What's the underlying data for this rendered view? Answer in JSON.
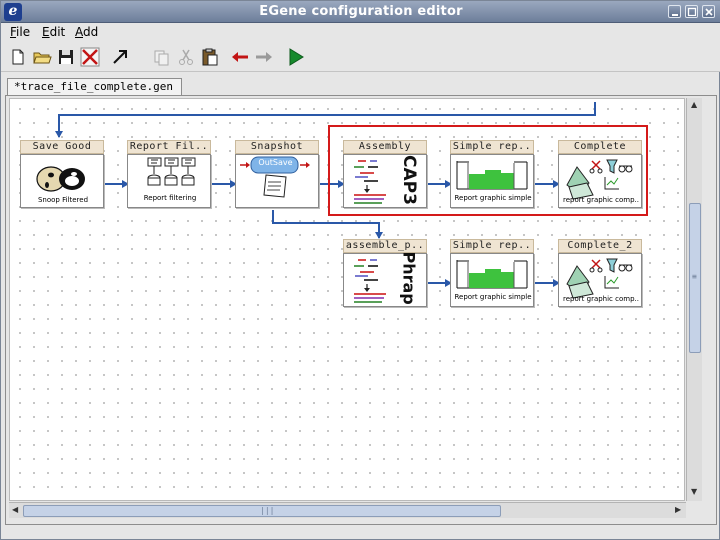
{
  "window": {
    "title": "EGene configuration editor",
    "logo_letter": "e"
  },
  "menubar": [
    {
      "label": "File",
      "mnemonic": "F",
      "rest": "ile"
    },
    {
      "label": "Edit",
      "mnemonic": "E",
      "rest": "dit"
    },
    {
      "label": "Add",
      "mnemonic": "A",
      "rest": "dd"
    }
  ],
  "toolbar": {
    "items": [
      "new-file-icon",
      "open-folder-icon",
      "save-icon",
      "delete-icon",
      "connect-arrow-icon",
      "copy-icon",
      "cut-icon",
      "paste-icon",
      "back-arrow-icon",
      "forward-arrow-icon",
      "run-icon"
    ]
  },
  "tab": {
    "label": "*trace_file_complete.gen"
  },
  "nodes": {
    "save_good": {
      "label": "Save Good",
      "caption": "Snoop Filtered"
    },
    "report_filtering": {
      "label": "Report Fil..",
      "caption": "Report filtering"
    },
    "snapshot": {
      "label": "Snapshot",
      "badge": "OutSave"
    },
    "assembly": {
      "label": "Assembly",
      "side_text": "CAP3"
    },
    "simple_rep_1": {
      "label": "Simple rep..",
      "caption": "Report graphic simple"
    },
    "complete_1": {
      "label": "Complete",
      "caption": "report graphic comp.."
    },
    "assemble_p": {
      "label": "assemble_p..",
      "side_text": "Phrap"
    },
    "simple_rep_2": {
      "label": "Simple rep..",
      "caption": "Report graphic simple"
    },
    "complete_2": {
      "label": "Complete_2",
      "caption": "report graphic comp.."
    }
  },
  "colors": {
    "edge": "#2a58a8",
    "highlight": "#d41a1a",
    "label_bg": "#efe4d2"
  }
}
